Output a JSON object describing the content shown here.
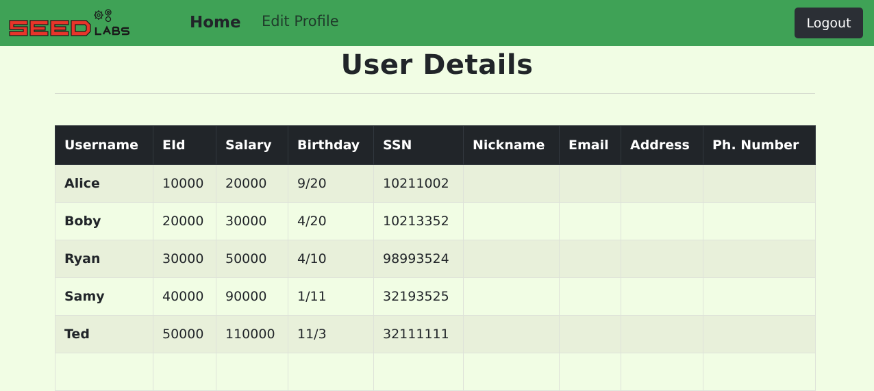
{
  "navbar": {
    "brand": "SEEDLABS",
    "links": [
      {
        "label": "Home",
        "active": true
      },
      {
        "label": "Edit Profile",
        "active": false
      }
    ],
    "logout_label": "Logout",
    "colors": {
      "background": "#3fa256",
      "logout_button": "#2b2f35"
    }
  },
  "main": {
    "title": "User Details",
    "table": {
      "headers": [
        "Username",
        "EId",
        "Salary",
        "Birthday",
        "SSN",
        "Nickname",
        "Email",
        "Address",
        "Ph. Number"
      ],
      "rows": [
        [
          "Alice",
          "10000",
          "20000",
          "9/20",
          "10211002",
          "",
          "",
          "",
          ""
        ],
        [
          "Boby",
          "20000",
          "30000",
          "4/20",
          "10213352",
          "",
          "",
          "",
          ""
        ],
        [
          "Ryan",
          "30000",
          "50000",
          "4/10",
          "98993524",
          "",
          "",
          "",
          ""
        ],
        [
          "Samy",
          "40000",
          "90000",
          "1/11",
          "32193525",
          "",
          "",
          "",
          ""
        ],
        [
          "Ted",
          "50000",
          "110000",
          "11/3",
          "32111111",
          "",
          "",
          "",
          ""
        ],
        [
          "",
          "",
          "",
          "",
          "",
          "",
          "",
          "",
          ""
        ]
      ]
    }
  },
  "colors": {
    "page_background": "#f1fde4",
    "header_background": "#212529"
  }
}
